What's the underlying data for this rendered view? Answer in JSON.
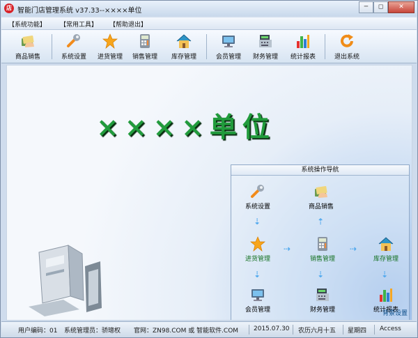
{
  "window": {
    "title": "智能门店管理系统 v37.33--××××单位",
    "app_icon_glyph": "店",
    "controls": {
      "minimize": "─",
      "restore": "◻",
      "close": "✕"
    }
  },
  "menu": [
    {
      "label": "【系统功能】"
    },
    {
      "label": "【常用工具】"
    },
    {
      "label": "【帮助退出】"
    }
  ],
  "toolbar": [
    {
      "label": "商品销售",
      "icon": "payment-icon"
    },
    {
      "label": "系统设置",
      "icon": "wrench-icon"
    },
    {
      "label": "进货管理",
      "icon": "star-icon"
    },
    {
      "label": "销售管理",
      "icon": "calculator-icon"
    },
    {
      "label": "库存管理",
      "icon": "house-icon"
    },
    {
      "label": "会员管理",
      "icon": "monitor-icon"
    },
    {
      "label": "财务管理",
      "icon": "cash-register-icon"
    },
    {
      "label": "统计报表",
      "icon": "bar-chart-icon"
    },
    {
      "label": "退出系统",
      "icon": "refresh-exit-icon"
    }
  ],
  "main": {
    "title": "××××单位"
  },
  "nav_panel": {
    "title": "系统操作导航",
    "items": [
      {
        "label": "系统设置",
        "icon": "wrench-icon"
      },
      {
        "label": "商品销售",
        "icon": "payment-icon"
      },
      {
        "label": "进货管理",
        "icon": "star-icon"
      },
      {
        "label": "销售管理",
        "icon": "calculator-icon"
      },
      {
        "label": "库存管理",
        "icon": "house-icon"
      },
      {
        "label": "会员管理",
        "icon": "monitor-icon"
      },
      {
        "label": "财务管理",
        "icon": "cash-register-icon"
      },
      {
        "label": "统计报表",
        "icon": "bar-chart-icon"
      }
    ],
    "bg_settings": "背景设置",
    "arrow_glyphs": {
      "down": "⇣",
      "up": "⇡",
      "right": "⇢"
    }
  },
  "status": {
    "user": "用户编码：01",
    "admin": "系统管理员：骄璁权",
    "website": "官网：ZN98.COM 或 智能软件.COM",
    "date": "2015.07.30",
    "lunar": "农历六月十五",
    "weekday": "星期四",
    "db": "Access"
  },
  "colors": {
    "title_text": "#219b3c",
    "title_shadow": "#092b10",
    "window_bg": "#cfdced",
    "toolbar_bg": "#d7e4f2",
    "accent_blue": "#52a9ee",
    "nav_border": "#8fa8c7"
  }
}
